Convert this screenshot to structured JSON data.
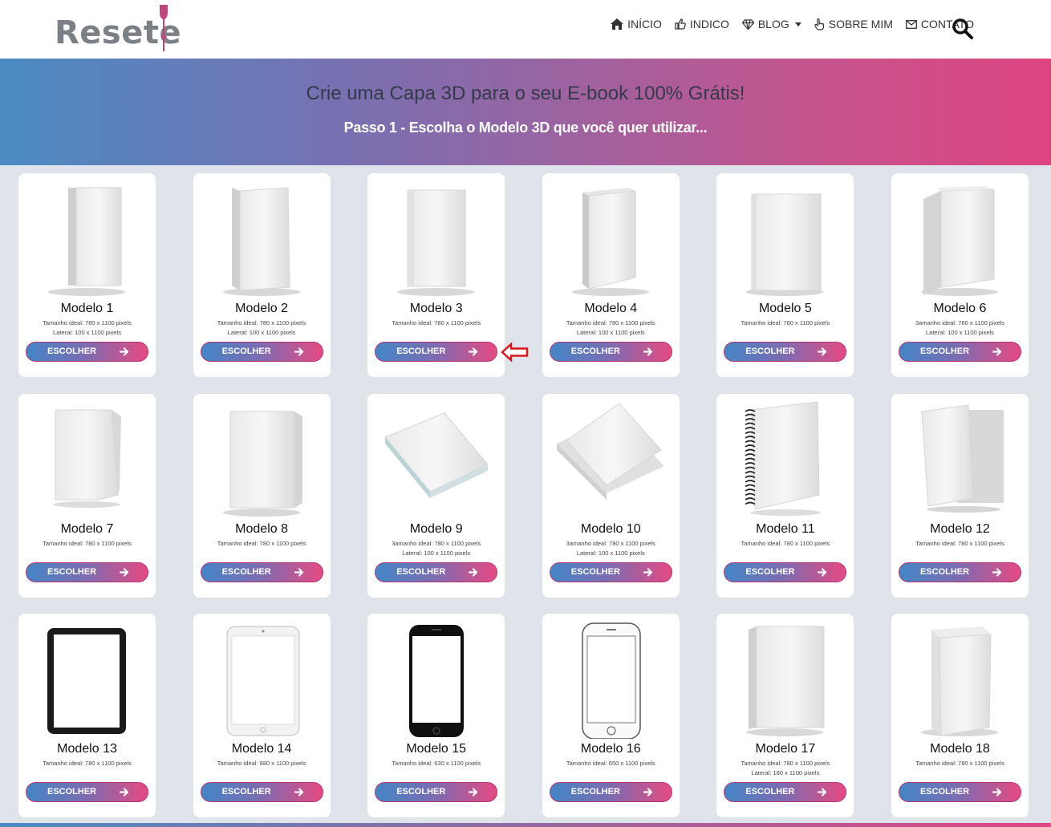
{
  "brand": {
    "logo_text": "Resete"
  },
  "nav": {
    "items": [
      {
        "label": "INÍCIO",
        "icon": "home-icon"
      },
      {
        "label": "INDICO",
        "icon": "thumbs-up-icon"
      },
      {
        "label": "BLOG",
        "icon": "diamond-icon",
        "has_dropdown": true
      },
      {
        "label": "SOBRE MIM",
        "icon": "pointer-hand-icon"
      },
      {
        "label": "CONTATO",
        "icon": "envelope-icon"
      }
    ],
    "search_icon": "search-icon"
  },
  "hero": {
    "title": "Crie uma Capa 3D para o seu E-book 100% Grátis!",
    "subtitle": "Passo 1 - Escolha o Modelo 3D que você quer utilizar..."
  },
  "button_label": "ESCOLHER",
  "models": [
    {
      "title": "Modelo 1",
      "spec1": "Tamanho ideal: 780 x 1100 pixels",
      "spec2": "Lateral: 100 x 1100 pixels",
      "kind": "book-standing"
    },
    {
      "title": "Modelo 2",
      "spec1": "Tamanho ideal: 780 x 1100 pixels",
      "spec2": "Lateral: 100 x 1100 pixels",
      "kind": "book-right"
    },
    {
      "title": "Modelo 3",
      "spec1": "Tamanho ideal: 780 x 1100 pixels",
      "spec2": "",
      "kind": "book-front"
    },
    {
      "title": "Modelo 4",
      "spec1": "Tamanho ideal: 780 x 1100 pixels",
      "spec2": "Lateral: 100 x 1100 pixels",
      "kind": "book-left"
    },
    {
      "title": "Modelo 5",
      "spec1": "Tamanho ideal: 780 x 1100 pixels",
      "spec2": "",
      "kind": "book-front-wide"
    },
    {
      "title": "Modelo 6",
      "spec1": "3amanho ideal: 780 x 1100 pixels",
      "spec2": "Lateral: 100 x 1100 pixels",
      "kind": "book-soft"
    },
    {
      "title": "Modelo 7",
      "spec1": "Tamanho ideal: 780 x 1100 pixels",
      "spec2": "",
      "kind": "magazine"
    },
    {
      "title": "Modelo 8",
      "spec1": "Tamanho ideal: 780 x 1100 pixels",
      "spec2": "",
      "kind": "book-plain"
    },
    {
      "title": "Modelo 9",
      "spec1": "3amanho ideal: 780 x 1100 pixels",
      "spec2": "Lateral: 100 x 1100 pixels",
      "kind": "book-lying"
    },
    {
      "title": "Modelo 10",
      "spec1": "3amanho ideal: 780 x 1100 pixels",
      "spec2": "Lateral: 100 x 1100 pixels",
      "kind": "book-open"
    },
    {
      "title": "Modelo 11",
      "spec1": "Tamanho ideal: 780 x 1100 pixels",
      "spec2": "",
      "kind": "spiral"
    },
    {
      "title": "Modelo 12",
      "spec1": "Tamanho ideal: 780 x 1100 pixels",
      "spec2": "",
      "kind": "folder"
    },
    {
      "title": "Modelo 13",
      "spec1": "Tamanho ideal: 780 x 1100 pixels",
      "spec2": "",
      "kind": "tablet-black"
    },
    {
      "title": "Modelo 14",
      "spec1": "Tamanho ideal: 880 x 1100 pixels",
      "spec2": "",
      "kind": "tablet-white"
    },
    {
      "title": "Modelo 15",
      "spec1": "Tamanho ideal: 630 x 1100 pixels",
      "spec2": "",
      "kind": "phone-black"
    },
    {
      "title": "Modelo 16",
      "spec1": "Tamanho ideal: 650 x 1100 pixels",
      "spec2": "",
      "kind": "phone-white"
    },
    {
      "title": "Modelo 17",
      "spec1": "Tamanho ideal: 780 x 1100 pixels",
      "spec2": "Lateral: 180 x 1100 pixels",
      "kind": "book-thick"
    },
    {
      "title": "Modelo 18",
      "spec1": "Tamanho ideal: 780 x 1100 pixels",
      "spec2": "",
      "kind": "box"
    }
  ]
}
